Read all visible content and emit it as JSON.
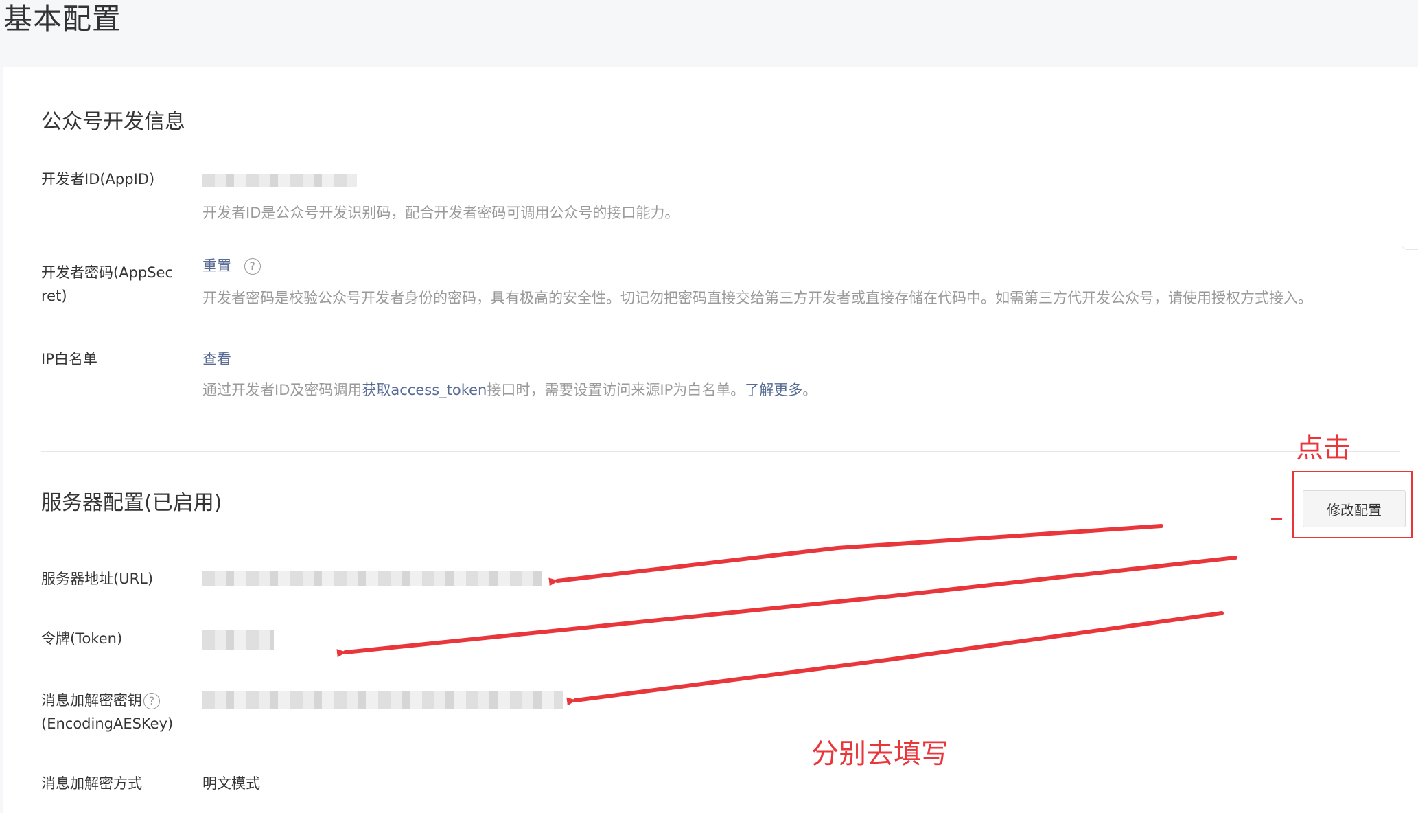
{
  "page": {
    "title": "基本配置"
  },
  "dev_info": {
    "title": "公众号开发信息",
    "appid": {
      "label": "开发者ID(AppID)",
      "desc": "开发者ID是公众号开发识别码，配合开发者密码可调用公众号的接口能力。"
    },
    "appsecret": {
      "label_line1": "开发者密码(AppSec",
      "label_line2": "ret)",
      "action": "重置",
      "help": "?",
      "desc": "开发者密码是校验公众号开发者身份的密码，具有极高的安全性。切记勿把密码直接交给第三方开发者或直接存储在代码中。如需第三方代开发公众号，请使用授权方式接入。"
    },
    "ip_whitelist": {
      "label": "IP白名单",
      "action": "查看",
      "desc_prefix": "通过开发者ID及密码调用",
      "desc_link": "获取access_token",
      "desc_middle": "接口时，需要设置访问来源IP为白名单。",
      "desc_more": "了解更多",
      "desc_suffix": "。"
    }
  },
  "server_config": {
    "title": "服务器配置(已启用)",
    "modify_button": "修改配置",
    "url": {
      "label": "服务器地址(URL)"
    },
    "token": {
      "label": "令牌(Token)"
    },
    "aes_key": {
      "label_line1": "消息加解密密钥",
      "label_line2": "(EncodingAESKey)",
      "help": "?"
    },
    "encrypt_mode": {
      "label": "消息加解密方式",
      "value": "明文模式"
    }
  },
  "annotations": {
    "click": "点击",
    "fill_each": "分别去填写",
    "color": "#e8363a"
  }
}
